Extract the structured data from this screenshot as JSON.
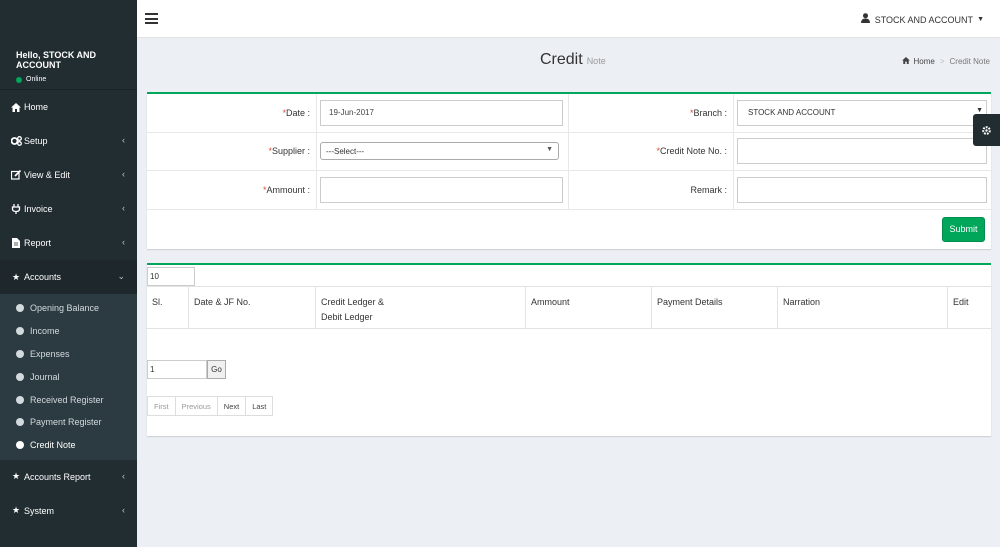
{
  "sidebar": {
    "greeting": "Hello, STOCK AND ACCOUNT",
    "status": "Online",
    "menu": [
      {
        "label": "Home"
      },
      {
        "label": "Setup"
      },
      {
        "label": "View & Edit"
      },
      {
        "label": "Invoice"
      },
      {
        "label": "Report"
      },
      {
        "label": "Accounts"
      }
    ],
    "accounts_submenu": [
      {
        "label": "Opening Balance"
      },
      {
        "label": "Income"
      },
      {
        "label": "Expenses"
      },
      {
        "label": "Journal"
      },
      {
        "label": "Received Register"
      },
      {
        "label": "Payment Register"
      },
      {
        "label": "Credit Note"
      }
    ],
    "menu_after": [
      {
        "label": "Accounts Report"
      },
      {
        "label": "System"
      }
    ]
  },
  "header": {
    "user": "STOCK AND ACCOUNT"
  },
  "page": {
    "title": "Credit",
    "subtitle": "Note",
    "breadcrumb_home": "Home",
    "breadcrumb_current": "Credit Note"
  },
  "form": {
    "req_mark": "*",
    "date_label": "Date :",
    "date_value": "19-Jun-2017",
    "branch_label": "Branch :",
    "branch_value": "STOCK AND ACCOUNT",
    "supplier_label": "Supplier :",
    "supplier_value": "---Select---",
    "credit_note_label": "Credit Note No. :",
    "credit_note_value": "",
    "amount_label": "Ammount :",
    "amount_value": "",
    "remark_label": "Remark :",
    "remark_value": "",
    "submit_label": "Submit"
  },
  "table": {
    "page_size": "10",
    "columns": [
      "Sl.",
      "Date & JF No.",
      "Credit Ledger &",
      "Ammount",
      "Payment Details",
      "Narration",
      "Edit"
    ],
    "column_3_line2": "Debit Ledger",
    "goto_value": "1",
    "go_label": "Go",
    "pager": [
      "First",
      "Previous",
      "Next",
      "Last"
    ]
  },
  "icons": {
    "accent_color": "#00a65a",
    "sidebar_color": "#222d32"
  }
}
